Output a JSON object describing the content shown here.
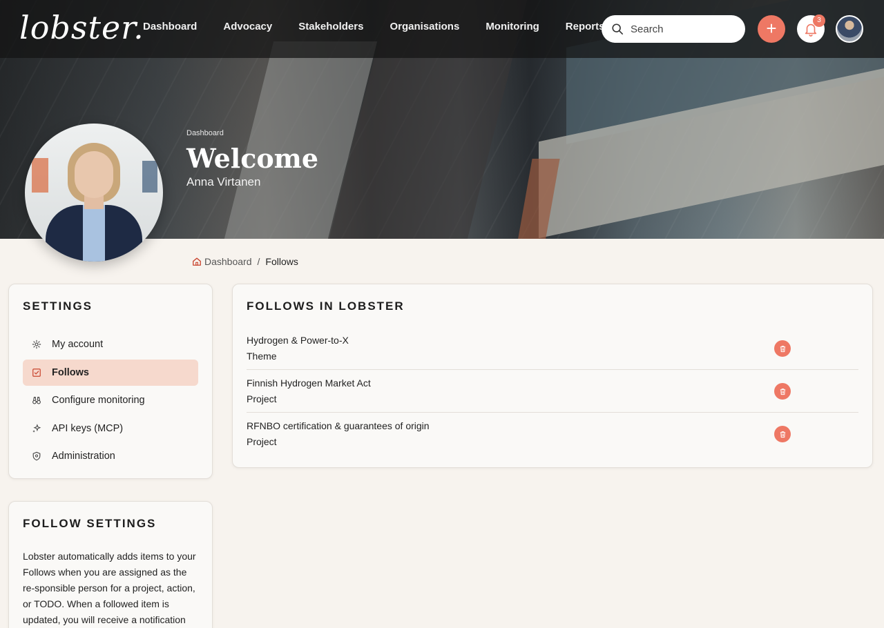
{
  "brand": {
    "logo": "lobster."
  },
  "nav": [
    "Dashboard",
    "Advocacy",
    "Stakeholders",
    "Organisations",
    "Monitoring",
    "Reports"
  ],
  "search": {
    "placeholder": "Search"
  },
  "actions": {
    "add_label": "+",
    "notification_count": "3"
  },
  "hero": {
    "breadcrumb": "Dashboard",
    "title": "Welcome",
    "user_name": "Anna Virtanen"
  },
  "breadcrumb": {
    "home": "Dashboard",
    "separator": "/",
    "current": "Follows"
  },
  "settings": {
    "title": "SETTINGS",
    "items": [
      {
        "label": "My account",
        "icon": "gear-icon",
        "active": false
      },
      {
        "label": "Follows",
        "icon": "checkbox-icon",
        "active": true
      },
      {
        "label": "Configure monitoring",
        "icon": "binoculars-icon",
        "active": false
      },
      {
        "label": "API keys (MCP)",
        "icon": "sparkle-icon",
        "active": false
      },
      {
        "label": "Administration",
        "icon": "shield-icon",
        "active": false
      }
    ]
  },
  "follows": {
    "title": "FOLLOWS IN LOBSTER",
    "items": [
      {
        "name": "Hydrogen & Power-to-X",
        "type": "Theme"
      },
      {
        "name": "Finnish Hydrogen Market Act",
        "type": "Project"
      },
      {
        "name": "RFNBO certification & guarantees of origin",
        "type": "Project"
      }
    ]
  },
  "follow_settings": {
    "title": "FOLLOW SETTINGS",
    "text": "Lobster automatically adds items to your Follows when you are assigned as the re-sponsible person for a project, action, or TODO. When a followed item is updated, you will receive a notification via email and"
  },
  "colors": {
    "accent": "#ee7864",
    "active_bg": "#f6d9cd",
    "page_bg": "#f7f3ee"
  }
}
